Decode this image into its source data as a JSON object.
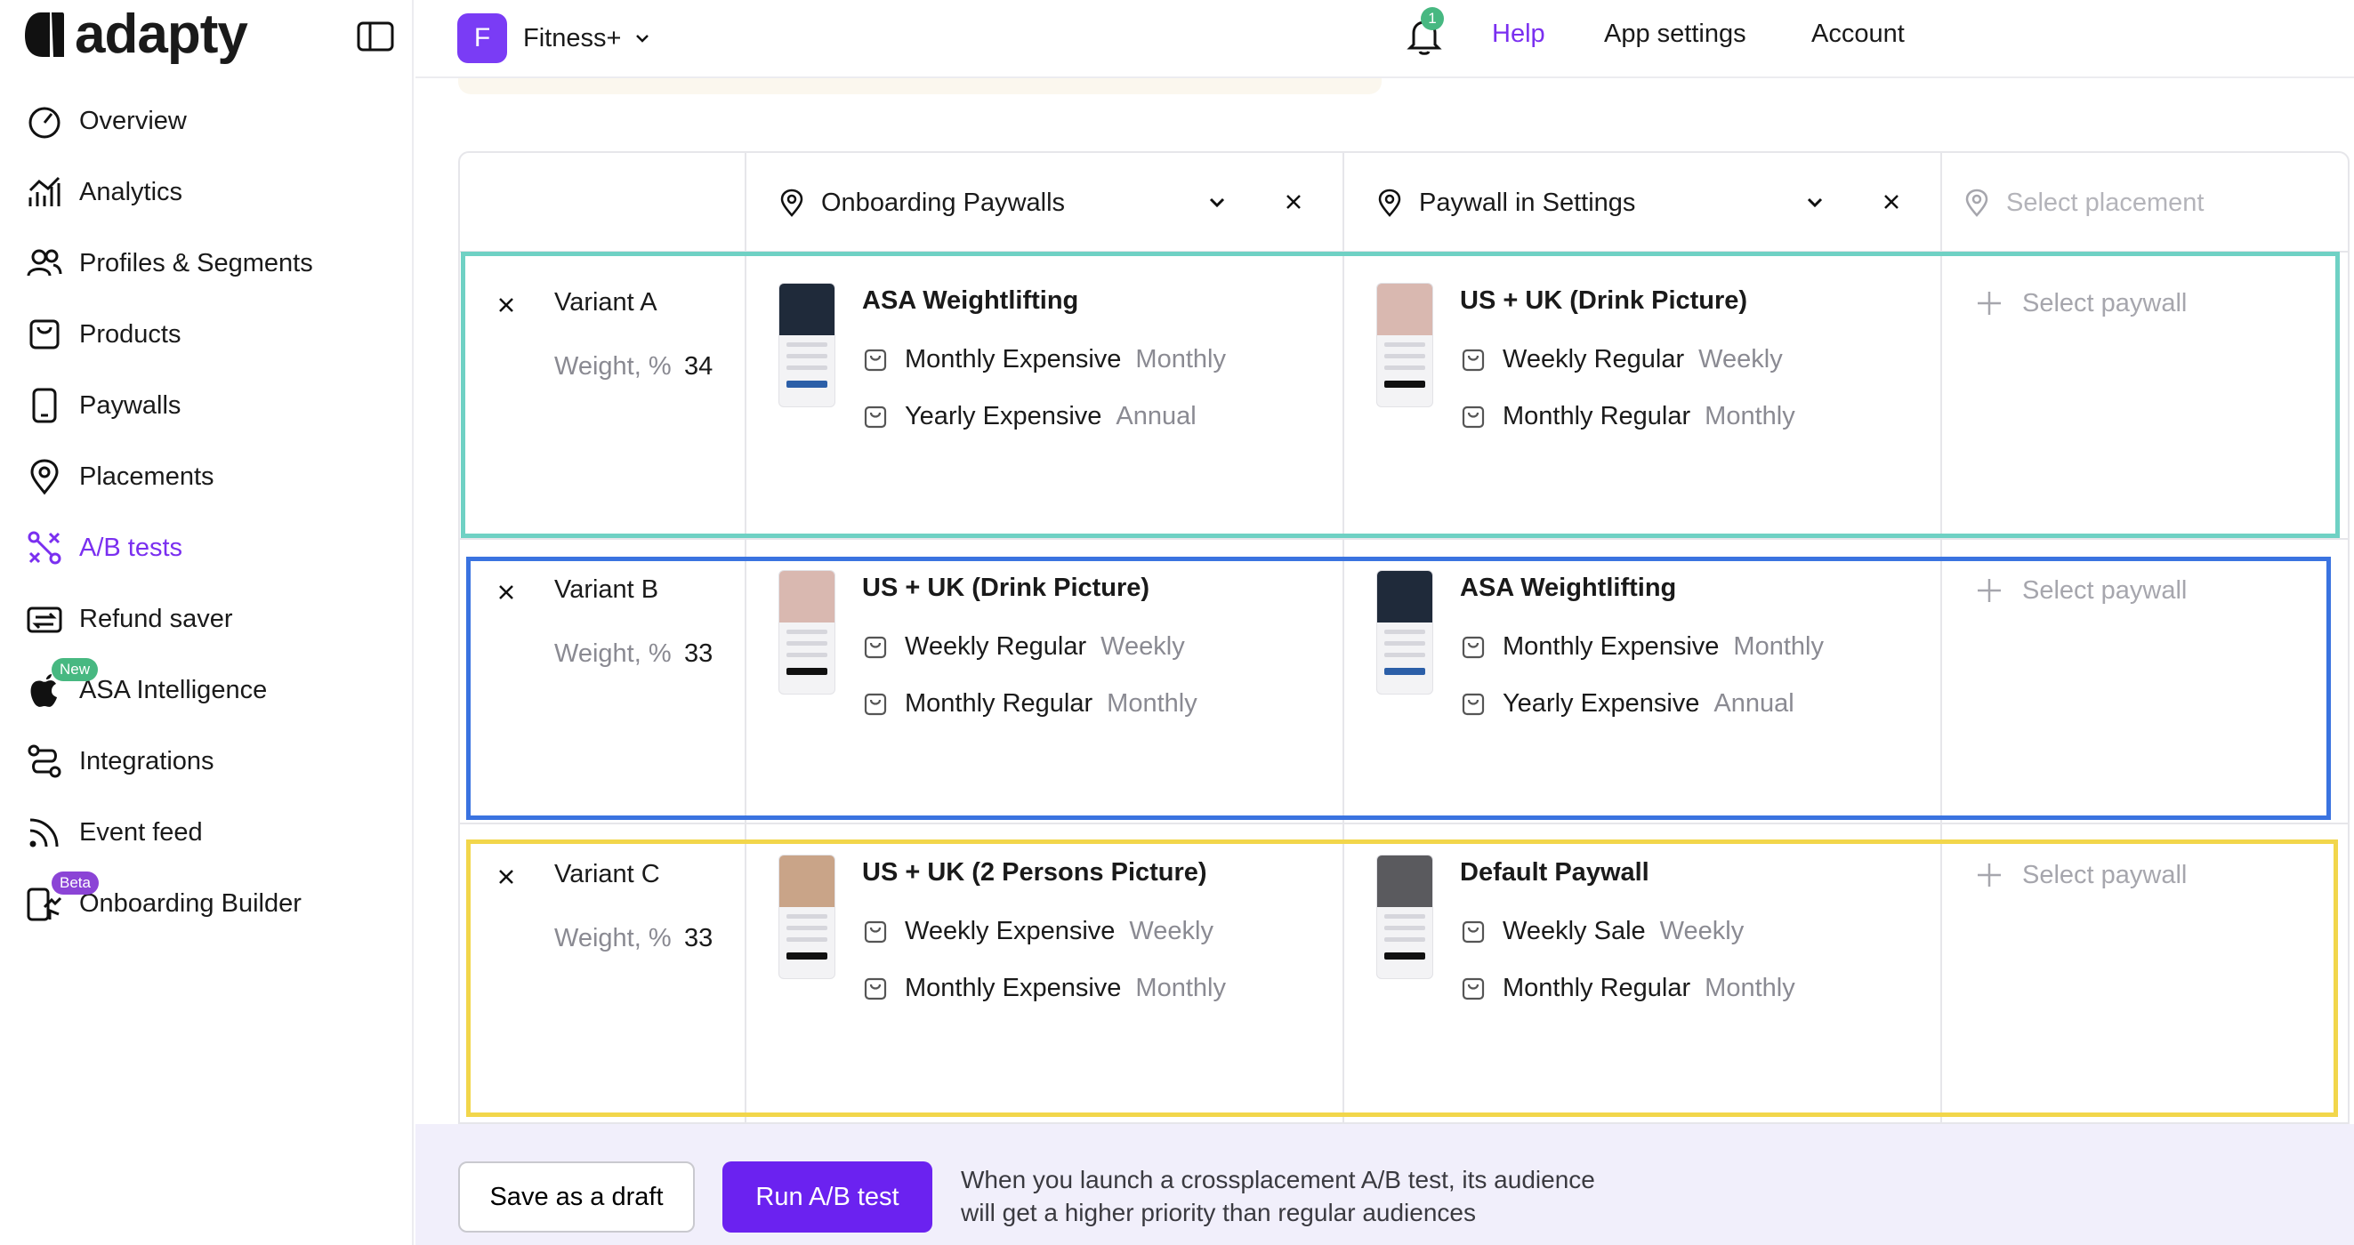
{
  "brand": {
    "name": "adapty"
  },
  "sidebar": {
    "items": [
      {
        "label": "Overview",
        "icon": "gauge-icon"
      },
      {
        "label": "Analytics",
        "icon": "analytics-icon"
      },
      {
        "label": "Profiles & Segments",
        "icon": "users-icon"
      },
      {
        "label": "Products",
        "icon": "product-icon"
      },
      {
        "label": "Paywalls",
        "icon": "phone-icon"
      },
      {
        "label": "Placements",
        "icon": "pin-icon"
      },
      {
        "label": "A/B tests",
        "icon": "ab-test-icon",
        "active": true
      },
      {
        "label": "Refund saver",
        "icon": "refund-icon"
      },
      {
        "label": "ASA Intelligence",
        "icon": "apple-icon",
        "badge": "New"
      },
      {
        "label": "Integrations",
        "icon": "integrations-icon"
      },
      {
        "label": "Event feed",
        "icon": "rss-icon"
      },
      {
        "label": "Onboarding Builder",
        "icon": "onboarding-icon",
        "badge": "Beta"
      }
    ]
  },
  "topbar": {
    "app_initial": "F",
    "app_name": "Fitness+",
    "notifications": "1",
    "help": "Help",
    "app_settings": "App settings",
    "account": "Account"
  },
  "placements": [
    {
      "label": "Onboarding Paywalls"
    },
    {
      "label": "Paywall in Settings"
    },
    {
      "placeholder": "Select placement"
    }
  ],
  "weight_label": "Weight, %",
  "select_paywall": "Select paywall",
  "variants": [
    {
      "name": "Variant A",
      "weight": "34",
      "outline_color": "#6fd1c4",
      "paywalls": [
        {
          "title": "ASA Weightlifting",
          "thumb": "dark",
          "products": [
            {
              "name": "Monthly Expensive",
              "period": "Monthly"
            },
            {
              "name": "Yearly Expensive",
              "period": "Annual"
            }
          ]
        },
        {
          "title": "US + UK (Drink Picture)",
          "thumb": "light",
          "products": [
            {
              "name": "Weekly Regular",
              "period": "Weekly"
            },
            {
              "name": "Monthly Regular",
              "period": "Monthly"
            }
          ]
        }
      ]
    },
    {
      "name": "Variant B",
      "weight": "33",
      "outline_color": "#3a73e0",
      "paywalls": [
        {
          "title": "US + UK (Drink Picture)",
          "thumb": "light",
          "products": [
            {
              "name": "Weekly Regular",
              "period": "Weekly"
            },
            {
              "name": "Monthly Regular",
              "period": "Monthly"
            }
          ]
        },
        {
          "title": "ASA Weightlifting",
          "thumb": "dark",
          "products": [
            {
              "name": "Monthly Expensive",
              "period": "Monthly"
            },
            {
              "name": "Yearly Expensive",
              "period": "Annual"
            }
          ]
        }
      ]
    },
    {
      "name": "Variant C",
      "weight": "33",
      "outline_color": "#f2d64b",
      "paywalls": [
        {
          "title": "US + UK (2 Persons Picture)",
          "thumb": "warm",
          "products": [
            {
              "name": "Weekly Expensive",
              "period": "Weekly"
            },
            {
              "name": "Monthly Expensive",
              "period": "Monthly"
            }
          ]
        },
        {
          "title": "Default Paywall",
          "thumb": "gray",
          "products": [
            {
              "name": "Weekly Sale",
              "period": "Weekly"
            },
            {
              "name": "Monthly Regular",
              "period": "Monthly"
            }
          ]
        }
      ]
    }
  ],
  "footer": {
    "save_draft": "Save as a draft",
    "run_test": "Run A/B test",
    "note_line1": "When you launch a crossplacement A/B test, its audience",
    "note_line2": "will get a higher priority than regular audiences"
  }
}
